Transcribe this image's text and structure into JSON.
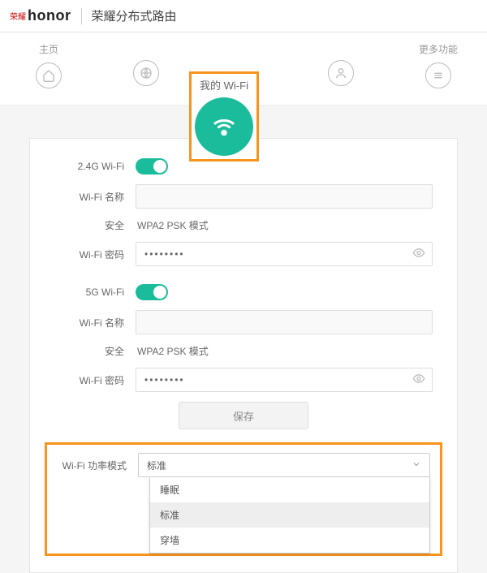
{
  "header": {
    "brand_prefix": "荣耀",
    "brand": "honor",
    "product": "荣耀分布式路由"
  },
  "nav": {
    "home": "主页",
    "active": "我的 Wi-Fi",
    "more": "更多功能"
  },
  "wifi24": {
    "section": "2.4G Wi-Fi",
    "name_label": "Wi-Fi 名称",
    "name_value": "",
    "security_label": "安全",
    "security_value": "WPA2 PSK 模式",
    "password_label": "Wi-Fi 密码",
    "password_value": "••••••••"
  },
  "wifi5": {
    "section": "5G Wi-Fi",
    "name_label": "Wi-Fi 名称",
    "name_value": "",
    "security_label": "安全",
    "security_value": "WPA2 PSK 模式",
    "password_label": "Wi-Fi 密码",
    "password_value": "••••••••"
  },
  "save_label": "保存",
  "power": {
    "label": "Wi-Fi 功率模式",
    "selected": "标准",
    "options": [
      "睡眠",
      "标准",
      "穿墙"
    ]
  }
}
